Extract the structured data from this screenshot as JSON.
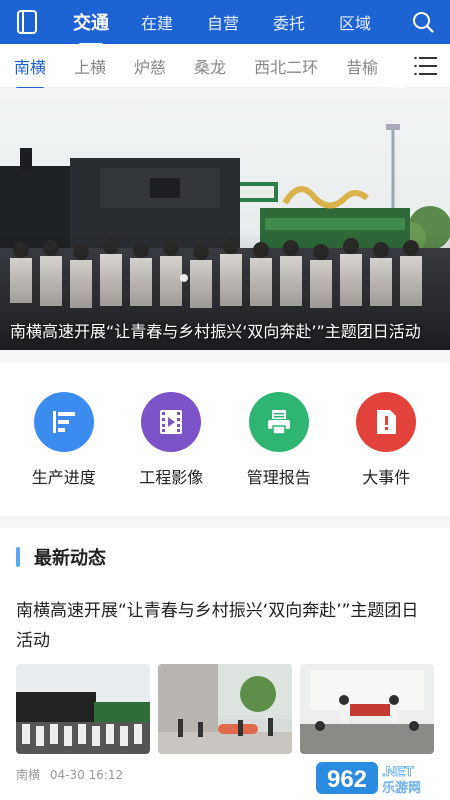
{
  "topnav": {
    "items": [
      "交通",
      "在建",
      "自营",
      "委托",
      "区域"
    ],
    "active_index": 0
  },
  "subnav": {
    "tabs": [
      "南横",
      "上横",
      "炉慈",
      "桑龙",
      "西北二环",
      "昔榆"
    ],
    "active_index": 0
  },
  "banner": {
    "caption": "南横高速开展“让青春与乡村振兴‘双向奔赴’”主题团日活动"
  },
  "quick_links": [
    {
      "label": "生产进度",
      "icon": "progress-icon",
      "color": "#3c8cf0"
    },
    {
      "label": "工程影像",
      "icon": "film-icon",
      "color": "#7b55c7"
    },
    {
      "label": "管理报告",
      "icon": "printer-icon",
      "color": "#2fb573"
    },
    {
      "label": "大事件",
      "icon": "alert-doc-icon",
      "color": "#e2433a"
    }
  ],
  "section": {
    "title": "最新动态"
  },
  "news": {
    "title": "南横高速开展“让青春与乡村振兴‘双向奔赴’”主题团日活动",
    "source": "南横",
    "time": "04-30 16:12"
  },
  "watermark": {
    "text": "962",
    "sub": "乐游网",
    "net": ".NET"
  },
  "colors": {
    "brand": "#1e63d3",
    "accent": "#5aa9f0"
  }
}
